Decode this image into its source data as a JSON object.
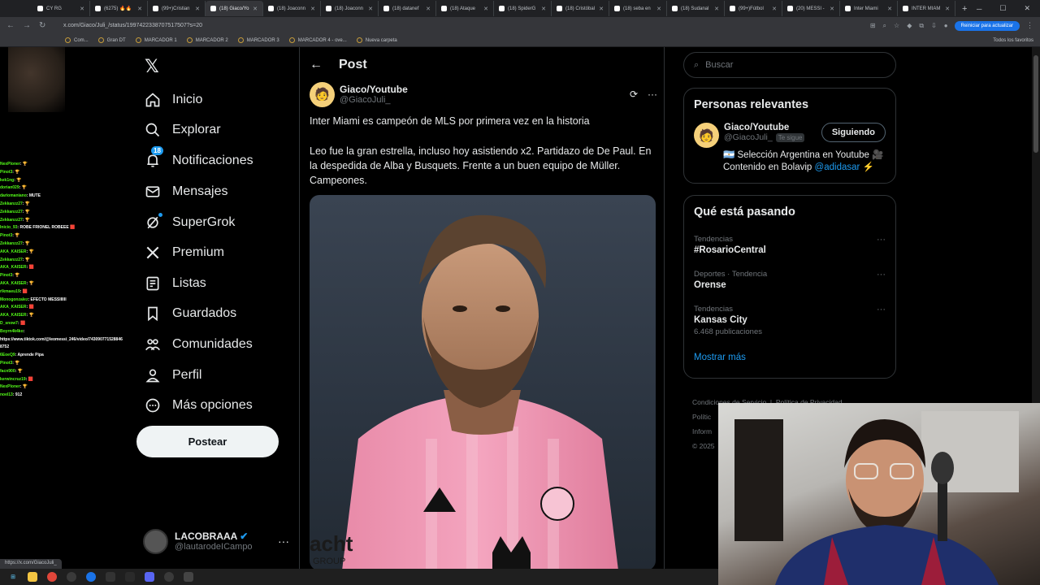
{
  "browser": {
    "tabs": [
      {
        "label": "CY RG"
      },
      {
        "label": "(6275) 🔥🔥"
      },
      {
        "label": "(99+)Cristian"
      },
      {
        "label": "(18) Giaco/Yo",
        "active": true
      },
      {
        "label": "(18) Joaconn"
      },
      {
        "label": "(18) Joaconn"
      },
      {
        "label": "(18) datanef"
      },
      {
        "label": "(18) Ataque"
      },
      {
        "label": "(18) SpiderG"
      },
      {
        "label": "(18) Cristóbal"
      },
      {
        "label": "(18) seba en"
      },
      {
        "label": "(18) Sudanal"
      },
      {
        "label": "(99+)Fútbol"
      },
      {
        "label": "(20) MESSI -"
      },
      {
        "label": "Inter Miami"
      },
      {
        "label": "INTER MIAM"
      }
    ],
    "url": "x.com/Giaco/Juli_/status/1997422338707517507?s=20",
    "update_label": "Reiniciar para actualizar",
    "bookmarks": [
      "Com...",
      "Gran DT",
      "MARCADOR 1",
      "MARCADOR 2",
      "MARCADOR 3",
      "MARCADOR 4 - ove...",
      "Nueva carpeta"
    ],
    "bookmarks_right": "Todos los favoritos",
    "status_url": "https://x.com/GiacoJuli_"
  },
  "chat": [
    {
      "user": "NexPloner",
      "msg": ": 🏆"
    },
    {
      "user": "Pinot3",
      "msg": ": 🏆"
    },
    {
      "user": "kek1ng",
      "msg": ": 🏆"
    },
    {
      "user": "dorian029",
      "msg": ": 🏆"
    },
    {
      "user": "dariomaniano",
      "msg": ": MUTE"
    },
    {
      "user": "Zekkanzz27",
      "msg": ": 🏆"
    },
    {
      "user": "Zekkanzz27",
      "msg": ": 🏆"
    },
    {
      "user": "Zekkanzz27",
      "msg": ": 🏆"
    },
    {
      "user": "Inicio_93",
      "msg": ": ROBE FRIONEL ROBEEE 🟥"
    },
    {
      "user": "Pinot3",
      "msg": ": 🏆"
    },
    {
      "user": "Zekkanzz27",
      "msg": ": 🏆"
    },
    {
      "user": "AKA_KAISER",
      "msg": ": 🏆"
    },
    {
      "user": "Zekkanzz27",
      "msg": ": 🏆"
    },
    {
      "user": "AKA_KAISER",
      "msg": ": 🟥"
    },
    {
      "user": "Pinot3",
      "msg": ": 🏆"
    },
    {
      "user": "AKA_KAISER",
      "msg": ": 🏆"
    },
    {
      "user": "rlkmaeu19",
      "msg": ": 🟥"
    },
    {
      "user": "Monogonzalez",
      "msg": ": EFECTO MESSIIIIII"
    },
    {
      "user": "AKA_KAISER",
      "msg": ": 🟥"
    },
    {
      "user": "AKA_KAISER",
      "msg": ": 🏆"
    },
    {
      "user": "D_snow7",
      "msg": ": 🟥"
    },
    {
      "user": "Boyrn4k4ko",
      "msg": ":"
    },
    {
      "user": "",
      "msg": "https://www.tiktok.com/@leomessi_246/video/743090771528846 8752"
    },
    {
      "user": "6EoeQ9",
      "msg": ": Aprende Pipa"
    },
    {
      "user": "Pinot3",
      "msg": ": 🏆"
    },
    {
      "user": "facn900",
      "msg": ": 🏆"
    },
    {
      "user": "kerwincruz19",
      "msg": ": 🟥"
    },
    {
      "user": "NexPloner",
      "msg": ": 🏆"
    },
    {
      "user": "noel13",
      "msg": ": 912"
    }
  ],
  "nav": {
    "items": [
      {
        "label": "Inicio",
        "icon": "home-icon"
      },
      {
        "label": "Explorar",
        "icon": "search-icon"
      },
      {
        "label": "Notificaciones",
        "icon": "bell-icon",
        "badge": "18"
      },
      {
        "label": "Mensajes",
        "icon": "mail-icon"
      },
      {
        "label": "SuperGrok",
        "icon": "grok-icon"
      },
      {
        "label": "Premium",
        "icon": "x-icon"
      },
      {
        "label": "Listas",
        "icon": "list-icon"
      },
      {
        "label": "Guardados",
        "icon": "bookmark-icon"
      },
      {
        "label": "Comunidades",
        "icon": "people-icon"
      },
      {
        "label": "Perfil",
        "icon": "person-icon"
      },
      {
        "label": "Más opciones",
        "icon": "more-circle-icon"
      }
    ],
    "post_button": "Postear",
    "account": {
      "name": "LACOBRAAA",
      "handle": "@lautarodeICampo"
    }
  },
  "post": {
    "header_title": "Post",
    "author_name": "Giaco/Youtube",
    "author_handle": "@GiacoJuli_",
    "text_1": "Inter Miami es campeón de MLS por primera vez en la historia",
    "text_2": "Leo fue la gran estrella, incluso hoy asistiendo x2. Partidazo de De Paul. En la despedida de Alba y Busquets. Frente a un buen equipo de Müller. Campeones."
  },
  "sidebar": {
    "search_placeholder": "Buscar",
    "relevant_title": "Personas relevantes",
    "relevant": {
      "name": "Giaco/Youtube",
      "handle": "@GiacoJuli_",
      "follows_you": "Te sigue",
      "button": "Siguiendo",
      "bio_1": "🇦🇷 Selección Argentina en Youtube 🎥",
      "bio_2": "Contenido en Bolavip",
      "bio_link": "@adidasar",
      "bio_end": "⚡"
    },
    "trends_title": "Qué está pasando",
    "trends": [
      {
        "meta": "Tendencias",
        "name": "#RosarioCentral",
        "count": ""
      },
      {
        "meta": "Deportes · Tendencia",
        "name": "Orense",
        "count": ""
      },
      {
        "meta": "Tendencias",
        "name": "Kansas City",
        "count": "6.468 publicaciones"
      }
    ],
    "show_more": "Mostrar más",
    "footer_1": "Condiciones de Servicio",
    "footer_2": "Política de Privacidad",
    "footer_3": "Polític",
    "footer_4": "Inform",
    "footer_5": "© 2025"
  },
  "media_text": {
    "sponsor": "acht",
    "sponsor_sub": "GROUP"
  }
}
